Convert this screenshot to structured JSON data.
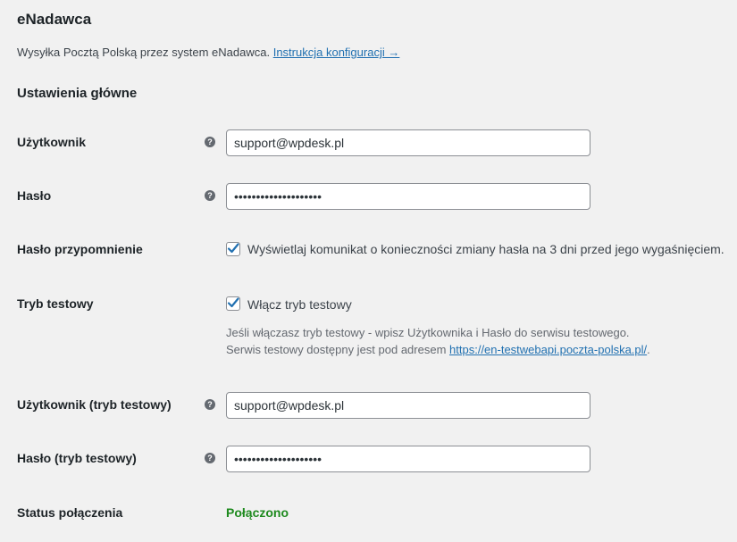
{
  "heading": "eNadawca",
  "intro": {
    "text": "Wysyłka Pocztą Polską przez system eNadawca.",
    "link": "Instrukcja konfiguracji →"
  },
  "section_title": "Ustawienia główne",
  "fields": {
    "user": {
      "label": "Użytkownik",
      "value": "support@wpdesk.pl"
    },
    "password": {
      "label": "Hasło",
      "value": "••••••••••••••••••••"
    },
    "password_reminder": {
      "label": "Hasło przypomnienie",
      "checkbox_label": "Wyświetlaj komunikat o konieczności zmiany hasła na 3 dni przed jego wygaśnięciem.",
      "checked": true
    },
    "test_mode": {
      "label": "Tryb testowy",
      "checkbox_label": "Włącz tryb testowy",
      "checked": true,
      "desc_line1": "Jeśli włączasz tryb testowy - wpisz Użytkownika i Hasło do serwisu testowego.",
      "desc_line2_prefix": "Serwis testowy dostępny jest pod adresem",
      "desc_link": "https://en-testwebapi.poczta-polska.pl/",
      "desc_suffix": "."
    },
    "test_user": {
      "label": "Użytkownik (tryb testowy)",
      "value": "support@wpdesk.pl"
    },
    "test_password": {
      "label": "Hasło (tryb testowy)",
      "value": "••••••••••••••••••••"
    },
    "connection_status": {
      "label": "Status połączenia",
      "value": "Połączono"
    }
  },
  "help_glyph": "?",
  "colors": {
    "background": "#f1f1f1",
    "link": "#2271b1",
    "status_ok": "#1e8a1e",
    "checkbox_accent": "#2271b1"
  }
}
